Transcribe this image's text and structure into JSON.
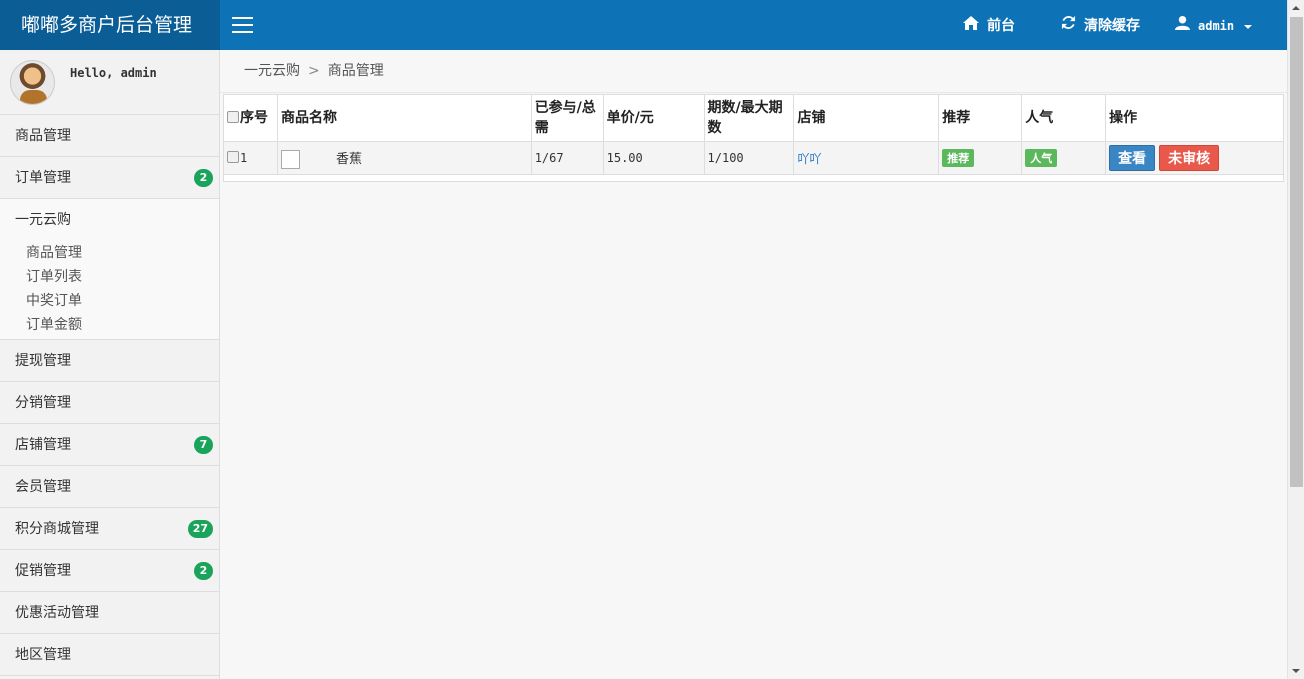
{
  "app": {
    "title": "嘟嘟多商户后台管理"
  },
  "header": {
    "menu_icon": "hamburger-icon",
    "front": {
      "icon": "home-icon",
      "label": "前台"
    },
    "cache": {
      "icon": "refresh-icon",
      "label": "清除缓存"
    },
    "user": {
      "icon": "user-icon",
      "label": "admin"
    }
  },
  "sidebar": {
    "greeting": "Hello, admin",
    "items": [
      {
        "label": "商品管理",
        "badge": ""
      },
      {
        "label": "订单管理",
        "badge": "2"
      },
      {
        "label": "一元云购",
        "badge": ""
      },
      {
        "label": "提现管理",
        "badge": ""
      },
      {
        "label": "分销管理",
        "badge": ""
      },
      {
        "label": "店铺管理",
        "badge": "7"
      },
      {
        "label": "会员管理",
        "badge": ""
      },
      {
        "label": "积分商城管理",
        "badge": "27"
      },
      {
        "label": "促销管理",
        "badge": "2"
      },
      {
        "label": "优惠活动管理",
        "badge": ""
      },
      {
        "label": "地区管理",
        "badge": ""
      }
    ],
    "subitems": [
      "商品管理",
      "订单列表",
      "中奖订单",
      "订单金额"
    ]
  },
  "breadcrumb": {
    "parent": "一元云购",
    "current": "商品管理"
  },
  "table": {
    "headers": [
      "序号",
      "商品名称",
      "已参与/总需",
      "单价/元",
      "期数/最大期数",
      "店铺",
      "推荐",
      "人气",
      "操作"
    ],
    "rows": [
      {
        "index": "1",
        "name": "香蕉",
        "participation": "1/67",
        "price": "15.00",
        "period": "1/100",
        "shop": "吖吖",
        "recommend": "推荐",
        "popular": "人气",
        "view": "查看",
        "audit": "未审核"
      }
    ]
  },
  "colors": {
    "header": "#0d72b6",
    "brand": "#0b5d96",
    "badge": "#1aa35a",
    "label": "#5cb85c",
    "view": "#3a86c4",
    "audit": "#e8594c"
  }
}
